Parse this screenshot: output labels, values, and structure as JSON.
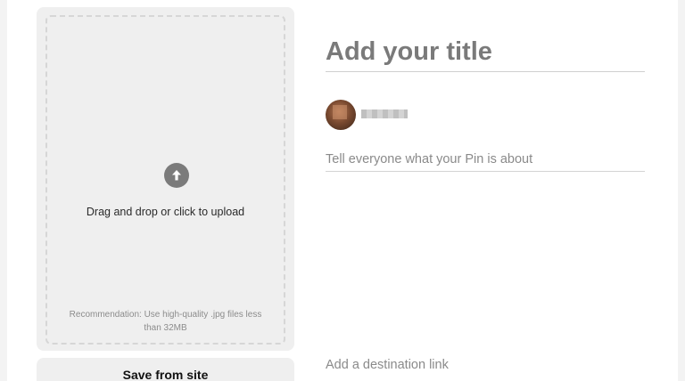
{
  "upload": {
    "dropzone_text": "Drag and drop or click to upload",
    "recommendation": "Recommendation: Use high-quality .jpg files less than 32MB",
    "icon": "arrow-up-circle-icon"
  },
  "save_from_site": {
    "label": "Save from site"
  },
  "pin": {
    "title_placeholder": "Add your title",
    "description_placeholder": "Tell everyone what your Pin is about",
    "link_placeholder": "Add a destination link"
  },
  "colors": {
    "panel_background": "#efefef",
    "upload_icon": "#7b7b7b",
    "title_text": "#7a7a7a"
  }
}
